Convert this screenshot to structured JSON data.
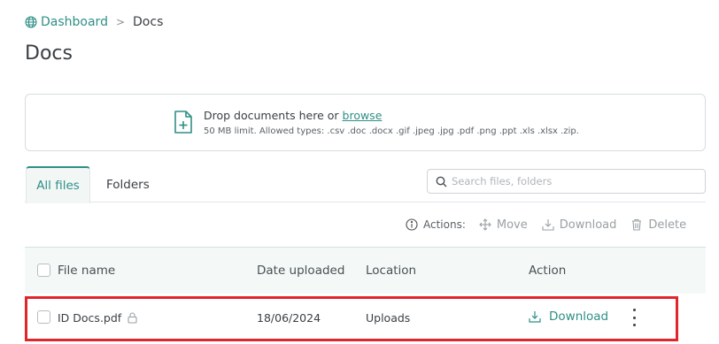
{
  "breadcrumb": {
    "parent": "Dashboard",
    "separator": ">",
    "current": "Docs"
  },
  "page_title": "Docs",
  "upload": {
    "prompt": "Drop documents here or",
    "browse_label": "browse",
    "limits": "50 MB limit. Allowed types: .csv .doc .docx .gif .jpeg .jpg .pdf .png .ppt .xls .xlsx .zip."
  },
  "tabs": [
    {
      "label": "All files",
      "active": true
    },
    {
      "label": "Folders",
      "active": false
    }
  ],
  "search": {
    "placeholder": "Search files, folders",
    "value": ""
  },
  "actions": {
    "label": "Actions:",
    "move_label": "Move",
    "download_label": "Download",
    "delete_label": "Delete"
  },
  "table": {
    "columns": [
      "File name",
      "Date uploaded",
      "Location",
      "Action"
    ],
    "rows": [
      {
        "file_name": "ID Docs.pdf",
        "locked": true,
        "date_uploaded": "18/06/2024",
        "location": "Uploads",
        "action_label": "Download"
      }
    ]
  },
  "colors": {
    "accent": "#2f8f86",
    "highlight": "#e0262b",
    "header_bg": "#f4f9f8",
    "disabled": "#9aa0a5"
  },
  "icons": [
    "globe-icon",
    "file-plus-icon",
    "search-icon",
    "info-icon",
    "move-icon",
    "download-icon",
    "trash-icon",
    "lock-icon",
    "more-vertical-icon"
  ]
}
